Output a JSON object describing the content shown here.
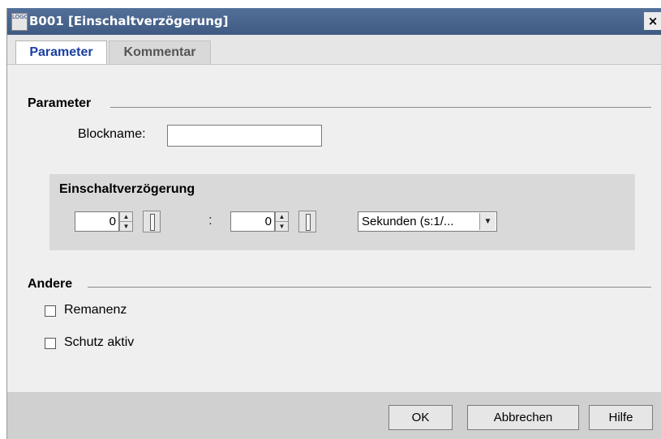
{
  "window": {
    "title": "B001 [Einschaltverzögerung]",
    "app_icon_text": "LOGO!",
    "close_glyph": "×"
  },
  "tabs": [
    {
      "label": "Parameter",
      "active": true
    },
    {
      "label": "Kommentar",
      "active": false
    }
  ],
  "parameter_section": {
    "title": "Parameter",
    "blockname_label": "Blockname:",
    "blockname_value": ""
  },
  "delay_group": {
    "title": "Einschaltverzögerung",
    "value_1": "0",
    "separator": ":",
    "value_2": "0",
    "unit_selected": "Sekunden (s:1/..."
  },
  "other_section": {
    "title": "Andere",
    "options": [
      {
        "label": "Remanenz",
        "checked": false
      },
      {
        "label": "Schutz aktiv",
        "checked": false
      }
    ]
  },
  "buttons": {
    "ok": "OK",
    "cancel": "Abbrechen",
    "help": "Hilfe"
  }
}
